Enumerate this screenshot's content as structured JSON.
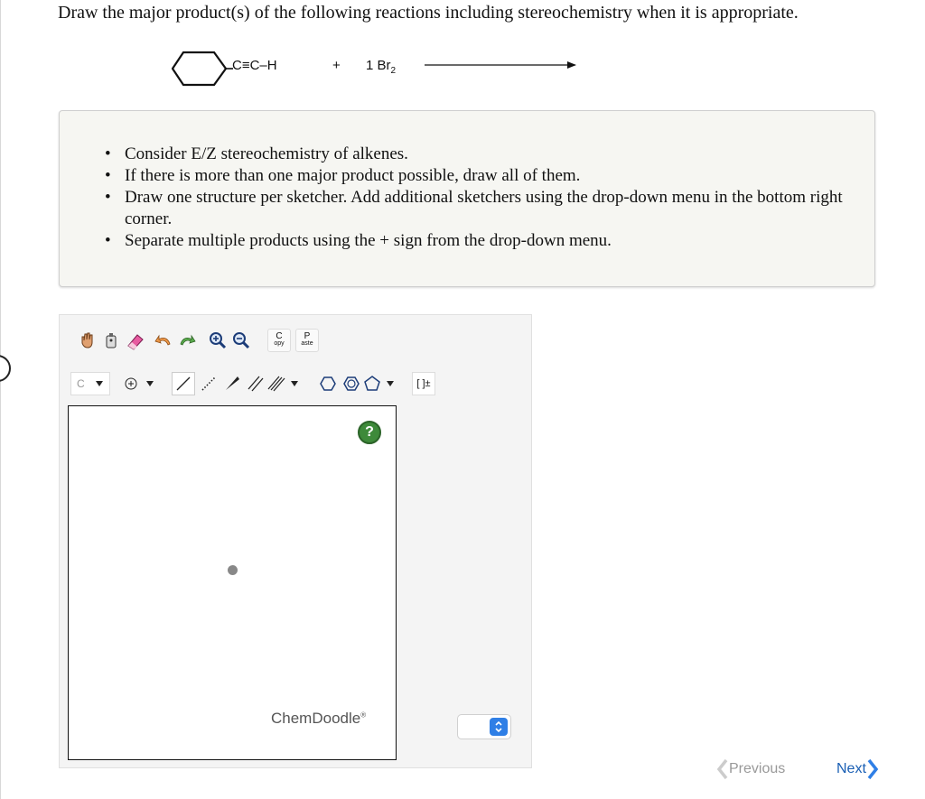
{
  "question": {
    "prompt": "Draw the major product(s) of the following reactions including stereochemistry when it is appropriate."
  },
  "reaction": {
    "substituent": "C≡C–H",
    "plus": "+",
    "reagent_coeff": "1 Br",
    "reagent_sub": "2"
  },
  "instructions": [
    "Consider E/Z stereochemistry of alkenes.",
    "If there is more than one major product possible, draw all of them.",
    "Draw one structure per sketcher. Add additional sketchers using the drop-down menu in the bottom right corner.",
    "Separate multiple products using the + sign from the drop-down menu."
  ],
  "toolbar": {
    "copy_top": "C",
    "copy_bottom": "opy",
    "paste_top": "P",
    "paste_bottom": "aste",
    "atom_label": "C",
    "bracket_label": "[ ]±"
  },
  "sketcher": {
    "help_label": "?",
    "brand": "ChemDoodle",
    "brand_mark": "®"
  },
  "navigation": {
    "previous": "Previous",
    "next": "Next"
  },
  "colors": {
    "accent_blue": "#2f7fe6",
    "help_green": "#3e8a3a",
    "link_blue": "#1a5fb4"
  }
}
